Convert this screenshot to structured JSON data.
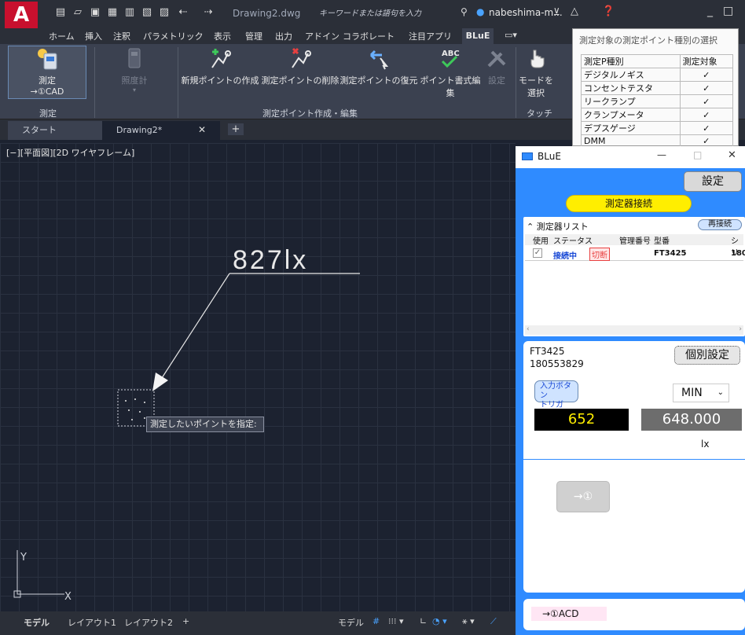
{
  "titlebar": {
    "doc_name": "Drawing2.dwg",
    "search_placeholder": "キーワードまたは語句を入力",
    "user": "nabeshima-m..."
  },
  "ribbon_tabs": [
    "ホーム",
    "挿入",
    "注釈",
    "パラメトリック",
    "表示",
    "管理",
    "出力",
    "アドイン",
    "コラボレート",
    "注目アプリ",
    "BLuE"
  ],
  "ribbon": {
    "measure": "測定\n→①CAD",
    "measure_line1": "測定",
    "measure_line2": "→①CAD",
    "illuminometer": "照度計",
    "new_point": "新規ポイントの作成",
    "delete_point": "測定ポイントの削除",
    "restore_point": "測定ポイントの復元",
    "format_edit": "ポイント書式編集",
    "settings": "設定",
    "mode_line1": "モードを",
    "mode_line2": "選択",
    "section_measure": "測定",
    "section_points": "測定ポイント作成・編集",
    "section_touch": "タッチ"
  },
  "file_tabs": {
    "start": "スタート",
    "drawing": "Drawing2*",
    "close": "✕",
    "add": "+"
  },
  "view_label": "[−][平面図][2D ワイヤフレーム]",
  "canvas": {
    "annotation": "827lx",
    "tooltip": "測定したいポイントを指定:",
    "axis_y": "Y",
    "axis_x": "X"
  },
  "status": {
    "model": "モデル",
    "layout1": "レイアウト1",
    "layout2": "レイアウト2",
    "add": "+",
    "model_right": "モデル"
  },
  "point_type_panel": {
    "title": "測定対象の測定ポイント種別の選択",
    "headers": [
      "測定P種別",
      "測定対象"
    ],
    "rows": [
      {
        "name": "デジタルノギス",
        "check": "✓"
      },
      {
        "name": "コンセントテスタ",
        "check": "✓"
      },
      {
        "name": "リークランプ",
        "check": "✓"
      },
      {
        "name": "クランプメータ",
        "check": "✓"
      },
      {
        "name": "デプスゲージ",
        "check": "✓"
      },
      {
        "name": "DMM",
        "check": "✓"
      }
    ]
  },
  "blue_window": {
    "title": "BLuE",
    "minimize": "—",
    "maximize": "□",
    "close": "✕",
    "settings_btn": "設定",
    "connect_btn": "測定器接続",
    "device_list_label": "測定器リスト",
    "reconnect_btn": "再接続",
    "table_headers": [
      "使用",
      "ステータス",
      "管理番号",
      "型番",
      "シリ"
    ],
    "table_row": {
      "use": "✓",
      "status": "接続中",
      "disconnect": "切断",
      "mgmt": "",
      "model": "FT3425",
      "serial": "180"
    },
    "device_model": "FT3425",
    "device_serial": "180553829",
    "individual_settings": "個別設定",
    "input_trigger_line1": "入力ボタン",
    "input_trigger_line2": "トリガ",
    "mode_select": "MIN",
    "value_live": "652",
    "value_measured": "648.000",
    "unit": "lx",
    "send_btn": "→①",
    "bottom_label": "→①ACD"
  }
}
